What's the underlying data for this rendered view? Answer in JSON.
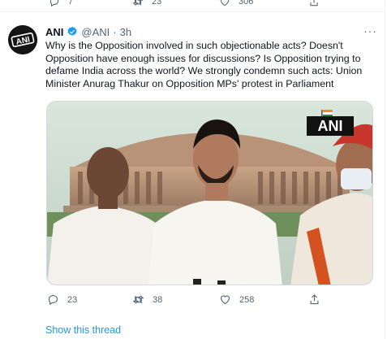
{
  "top_actions": {
    "replies": "7",
    "retweets": "23",
    "likes": "306"
  },
  "tweet": {
    "name": "ANI",
    "handle": "@ANI",
    "dot": "·",
    "time": "3h",
    "avatar_text": "ANI",
    "text": "Why is the Opposition involved in such objectionable acts? Doesn't Opposition have enough issues for discussions? Is Opposition trying to defame India across the world? We strongly condemn such acts: Union Minister Anurag Thakur on Opposition MPs' protest in Parliament",
    "media_watermark": "ANI",
    "replies": "23",
    "retweets": "38",
    "likes": "258",
    "more": "···"
  },
  "show_thread": "Show this thread",
  "colors": {
    "accent": "#1d9bf0",
    "text": "#0f1419",
    "muted": "#536471",
    "border": "#cfd9de"
  }
}
